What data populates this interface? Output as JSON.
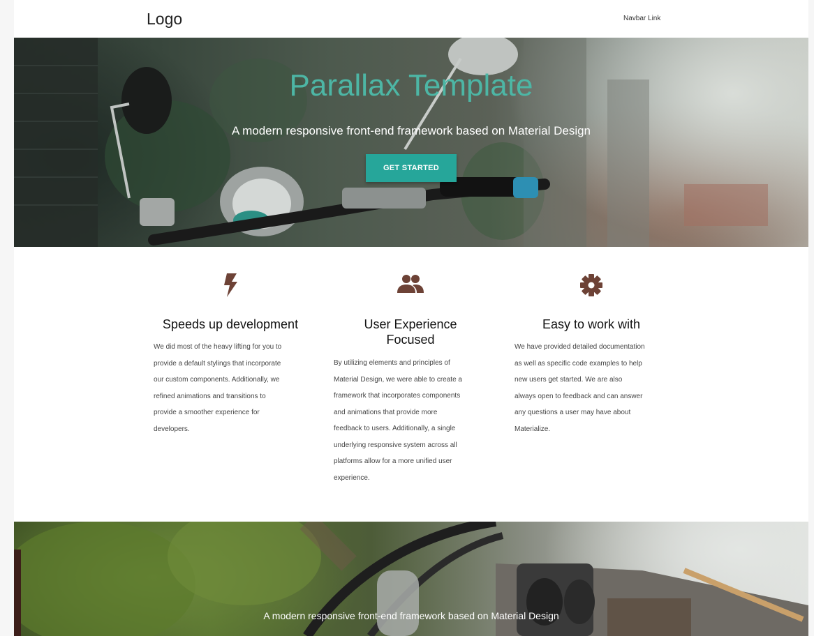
{
  "navbar": {
    "logo": "Logo",
    "link": "Navbar Link"
  },
  "hero": {
    "title": "Parallax Template",
    "subtitle": "A modern responsive front-end framework based on Material Design",
    "cta_label": "GET STARTED"
  },
  "features": [
    {
      "icon": "flash-icon",
      "title": "Speeds up development",
      "lines": [
        "We did most of the heavy lifting for you to",
        "provide a default stylings that incorporate",
        "our custom components. Additionally, we",
        "refined animations and transitions to",
        "provide a smoother experience for",
        "developers."
      ]
    },
    {
      "icon": "group-icon",
      "title_lines": [
        "User Experience",
        "Focused"
      ],
      "lines": [
        "By utilizing elements and principles of",
        "Material Design, we were able to create a",
        "framework that incorporates components",
        "and animations that provide more",
        "feedback to users. Additionally, a single",
        "underlying responsive system across all",
        "platforms allow for a more unified user",
        "experience."
      ]
    },
    {
      "icon": "settings-icon",
      "title": "Easy to work with",
      "lines": [
        "We have provided detailed documentation",
        "as well as specific code examples to help",
        "new users get started. We are also",
        "always open to feedback and can answer",
        "any questions a user may have about",
        "Materialize."
      ]
    }
  ],
  "parallax2": {
    "subtitle": "A modern responsive front-end framework based on Material Design"
  },
  "colors": {
    "accent": "#26a69a",
    "title_teal": "#4db6a5",
    "icon_brown": "#6d4236"
  }
}
